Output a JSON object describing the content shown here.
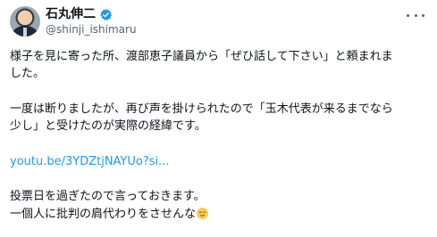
{
  "author": {
    "display_name": "石丸伸二",
    "handle": "@shinji_ishimaru",
    "avatar_icon": "profile-photo",
    "verified_icon": "verified-badge-icon",
    "verified_color": "#1d9bf0"
  },
  "tweet": {
    "paragraph1_line1": "様子を見に寄った所、渡部恵子議員から「ぜひ話して下さい」と頼まれま",
    "paragraph1_line2": "した。",
    "paragraph2_line1": "一度は断りましたが、再び声を掛けられたので「玉木代表が来るまでなら",
    "paragraph2_line2": "少し」と受けたのが実際の経緯です。",
    "link_text": "youtu.be/3YDZtjNAYUo?si...",
    "paragraph3_line1": "投票日を過ぎたので言っておきます。",
    "paragraph3_line2": "一個人に批判の肩代わりをさせんな",
    "emoji_icon": "smirking-face-emoji"
  },
  "colors": {
    "text": "#0f1419",
    "secondary": "#536471",
    "link": "#1d9bf0"
  }
}
